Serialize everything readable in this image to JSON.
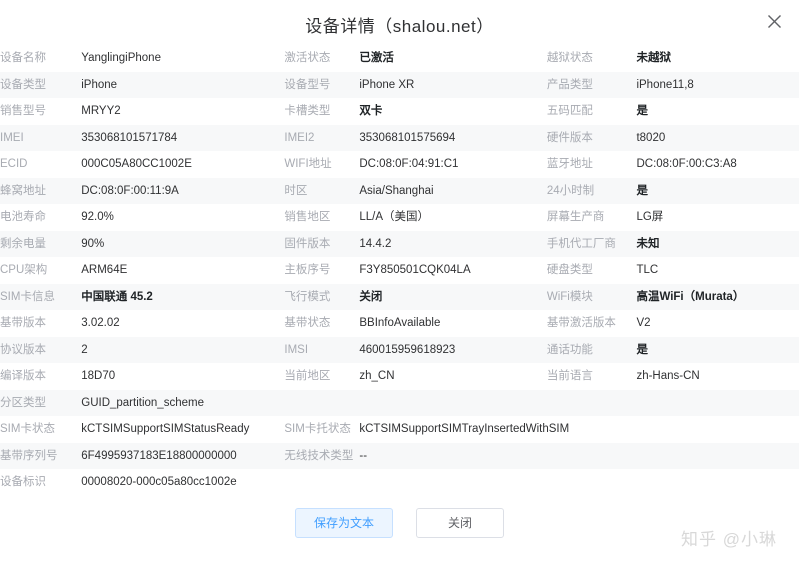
{
  "dialog": {
    "title": "设备详情（shalou.net）",
    "close_icon": "close-icon"
  },
  "rows": [
    {
      "striped": false,
      "cells": [
        {
          "label": "设备名称",
          "value": "YanglingiPhone",
          "bold": false
        },
        {
          "label": "激活状态",
          "value": "已激活",
          "bold": true
        },
        {
          "label": "越狱状态",
          "value": "未越狱",
          "bold": true
        }
      ]
    },
    {
      "striped": true,
      "cells": [
        {
          "label": "设备类型",
          "value": "iPhone",
          "bold": false
        },
        {
          "label": "设备型号",
          "value": "iPhone XR",
          "bold": false
        },
        {
          "label": "产品类型",
          "value": "iPhone11,8",
          "bold": false
        }
      ]
    },
    {
      "striped": false,
      "cells": [
        {
          "label": "销售型号",
          "value": "MRYY2",
          "bold": false
        },
        {
          "label": "卡槽类型",
          "value": "双卡",
          "bold": true
        },
        {
          "label": "五码匹配",
          "value": "是",
          "bold": true
        }
      ]
    },
    {
      "striped": true,
      "cells": [
        {
          "label": "IMEI",
          "value": "353068101571784",
          "bold": false
        },
        {
          "label": "IMEI2",
          "value": "353068101575694",
          "bold": false
        },
        {
          "label": "硬件版本",
          "value": "t8020",
          "bold": false
        }
      ]
    },
    {
      "striped": false,
      "cells": [
        {
          "label": "ECID",
          "value": "000C05A80CC1002E",
          "bold": false
        },
        {
          "label": "WIFI地址",
          "value": "DC:08:0F:04:91:C1",
          "bold": false
        },
        {
          "label": "蓝牙地址",
          "value": "DC:08:0F:00:C3:A8",
          "bold": false
        }
      ]
    },
    {
      "striped": true,
      "cells": [
        {
          "label": "蜂窝地址",
          "value": "DC:08:0F:00:11:9A",
          "bold": false
        },
        {
          "label": "时区",
          "value": "Asia/Shanghai",
          "bold": false
        },
        {
          "label": "24小时制",
          "value": "是",
          "bold": true
        }
      ]
    },
    {
      "striped": false,
      "cells": [
        {
          "label": "电池寿命",
          "value": "92.0%",
          "bold": false
        },
        {
          "label": "销售地区",
          "value": "LL/A（美国）",
          "bold": false
        },
        {
          "label": "屏幕生产商",
          "value": "LG屏",
          "bold": false
        }
      ]
    },
    {
      "striped": true,
      "cells": [
        {
          "label": "剩余电量",
          "value": "90%",
          "bold": false
        },
        {
          "label": "固件版本",
          "value": "14.4.2",
          "bold": false
        },
        {
          "label": "手机代工厂商",
          "value": "未知",
          "bold": true
        }
      ]
    },
    {
      "striped": false,
      "cells": [
        {
          "label": "CPU架构",
          "value": "ARM64E",
          "bold": false
        },
        {
          "label": "主板序号",
          "value": "F3Y850501CQK04LA",
          "bold": false
        },
        {
          "label": "硬盘类型",
          "value": "TLC",
          "bold": false
        }
      ]
    },
    {
      "striped": true,
      "cells": [
        {
          "label": "SIM卡信息",
          "value": "中国联通 45.2",
          "bold": true
        },
        {
          "label": "飞行模式",
          "value": "关闭",
          "bold": true
        },
        {
          "label": "WiFi模块",
          "value": "高温WiFi（Murata）",
          "bold": true
        }
      ]
    },
    {
      "striped": false,
      "cells": [
        {
          "label": "基带版本",
          "value": "3.02.02",
          "bold": false
        },
        {
          "label": "基带状态",
          "value": "BBInfoAvailable",
          "bold": false
        },
        {
          "label": "基带激活版本",
          "value": "V2",
          "bold": false
        }
      ]
    },
    {
      "striped": true,
      "cells": [
        {
          "label": "协议版本",
          "value": "2",
          "bold": false
        },
        {
          "label": "IMSI",
          "value": "460015959618923",
          "bold": false
        },
        {
          "label": "通话功能",
          "value": "是",
          "bold": true
        }
      ]
    },
    {
      "striped": false,
      "cells": [
        {
          "label": "编译版本",
          "value": "18D70",
          "bold": false
        },
        {
          "label": "当前地区",
          "value": "zh_CN",
          "bold": false
        },
        {
          "label": "当前语言",
          "value": "zh-Hans-CN",
          "bold": false
        }
      ]
    },
    {
      "striped": true,
      "cells": [
        {
          "label": "分区类型",
          "value": "GUID_partition_scheme",
          "bold": false
        }
      ]
    },
    {
      "striped": false,
      "cells": [
        {
          "label": "SIM卡状态",
          "value": "kCTSIMSupportSIMStatusReady",
          "bold": false
        },
        {
          "label": "SIM卡托状态",
          "value": "kCTSIMSupportSIMTrayInsertedWithSIM",
          "bold": false
        }
      ]
    },
    {
      "striped": true,
      "cells": [
        {
          "label": "基带序列号",
          "value": "6F4995937183E18800000000",
          "bold": false
        },
        {
          "label": "无线技术类型",
          "value": "--",
          "bold": false
        }
      ]
    },
    {
      "striped": false,
      "cells": [
        {
          "label": "设备标识",
          "value": "00008020-000c05a80cc1002e",
          "bold": false
        }
      ]
    }
  ],
  "footer": {
    "save_label": "保存为文本",
    "close_label": "关闭"
  },
  "watermark": "知乎 @小琳",
  "colors": {
    "accent": "#409eff",
    "accent_bg": "#ecf5ff",
    "stripe": "#f7f8f9",
    "label": "#a8abb2",
    "value": "#303133",
    "watermark": "#d8d8d8"
  }
}
